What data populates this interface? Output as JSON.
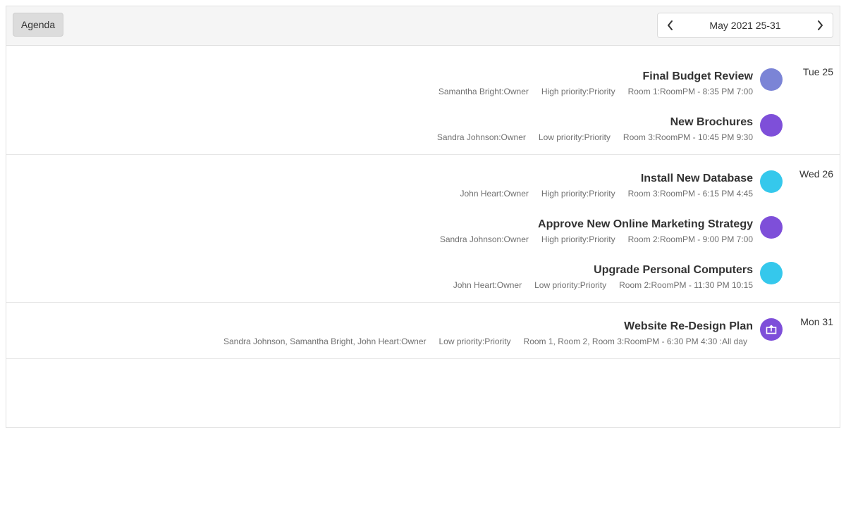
{
  "toolbar": {
    "view_label": "Agenda",
    "date_caption": "May 2021 25-31",
    "prev_icon": "chevron-left-icon",
    "next_icon": "chevron-right-icon"
  },
  "colors": {
    "room1": "#7b84d6",
    "room2": "#7e4fd9",
    "room3": "#35c8ec"
  },
  "days": [
    {
      "label": "Tue 25",
      "appointments": [
        {
          "title": "Final Budget Review",
          "owner": "Samantha Bright:Owner",
          "priority": "High priority:Priority",
          "room_time": "Room 1:RoomPM - 8:35 PM 7:00",
          "color": "#7b84d6"
        },
        {
          "title": "New Brochures",
          "owner": "Sandra Johnson:Owner",
          "priority": "Low priority:Priority",
          "room_time": "Room 3:RoomPM - 10:45 PM 9:30",
          "color": "#7e4fd9"
        }
      ]
    },
    {
      "label": "Wed 26",
      "appointments": [
        {
          "title": "Install New Database",
          "owner": "John Heart:Owner",
          "priority": "High priority:Priority",
          "room_time": "Room 3:RoomPM - 6:15 PM 4:45",
          "color": "#35c8ec"
        },
        {
          "title": "Approve New Online Marketing Strategy",
          "owner": "Sandra Johnson:Owner",
          "priority": "High priority:Priority",
          "room_time": "Room 2:RoomPM - 9:00 PM 7:00",
          "color": "#7e4fd9"
        },
        {
          "title": "Upgrade Personal Computers",
          "owner": "John Heart:Owner",
          "priority": "Low priority:Priority",
          "room_time": "Room 2:RoomPM - 11:30 PM 10:15",
          "color": "#35c8ec"
        }
      ]
    },
    {
      "label": "Mon 31",
      "appointments": [
        {
          "title": "Website Re-Design Plan",
          "owner": "Sandra Johnson, Samantha Bright, John Heart:Owner",
          "priority": "Low priority:Priority",
          "room_time": "Room 1, Room 2, Room 3:RoomPM - 6:30 PM 4:30 :All day",
          "color": "#7e4fd9",
          "icon": "recurrence-icon"
        }
      ]
    }
  ]
}
